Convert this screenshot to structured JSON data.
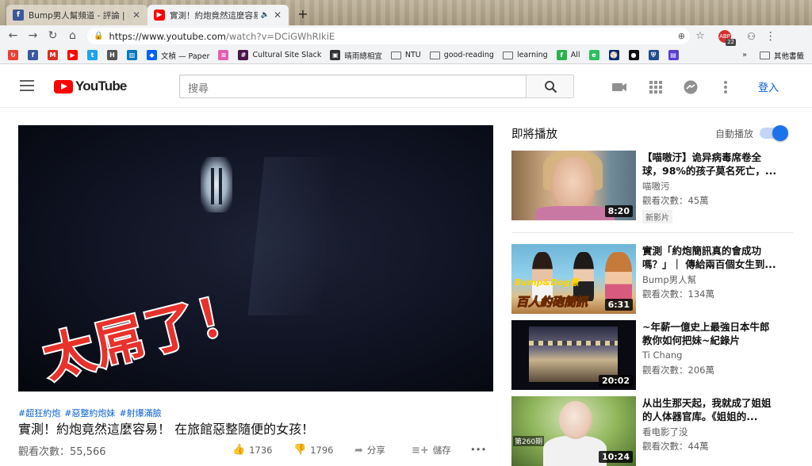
{
  "browser": {
    "tabs": [
      {
        "title": "Bump男人幫頻道 - 評論 | Facebook",
        "favicon": "facebook-icon",
        "active": false
      },
      {
        "title": "實測！約炮竟然這麼容易！在旅館",
        "favicon": "youtube-icon",
        "active": true
      }
    ],
    "url_host": "https://www.youtube.com",
    "url_path": "/watch?v=DCiGWhRIkiE",
    "ext_badge_count": "22",
    "ext_badge_label": "ABP",
    "bookmarks": [
      {
        "label": "",
        "icon": "refresh-red-icon",
        "color": "#e94235"
      },
      {
        "label": "",
        "icon": "facebook-icon",
        "color": "#3b5998"
      },
      {
        "label": "",
        "icon": "gmail-icon",
        "color": "#d93025"
      },
      {
        "label": "",
        "icon": "youtube-icon",
        "color": "#ff0000"
      },
      {
        "label": "",
        "icon": "twitter-icon",
        "color": "#1da1f2"
      },
      {
        "label": "",
        "icon": "hackmd-icon",
        "color": "#555555"
      },
      {
        "label": "",
        "icon": "trello-icon",
        "color": "#0079bf"
      },
      {
        "label": "文楨 — Paper",
        "icon": "dropbox-icon",
        "color": "#0061ff"
      },
      {
        "label": "",
        "icon": "pattern-icon",
        "color": "#e05fae"
      },
      {
        "label": "Cultural Site Slack",
        "icon": "slack-icon",
        "color": "#4a154b"
      },
      {
        "label": "晴雨總相宜",
        "icon": "blog-icon",
        "color": "#333333"
      },
      {
        "label": "NTU",
        "icon": "folder-icon",
        "color": ""
      },
      {
        "label": "good-reading",
        "icon": "folder-icon",
        "color": ""
      },
      {
        "label": "learning",
        "icon": "folder-icon",
        "color": ""
      },
      {
        "label": "All",
        "icon": "feedly-icon",
        "color": "#2bb24c"
      },
      {
        "label": "",
        "icon": "evernote-icon",
        "color": "#2dbe60"
      },
      {
        "label": "",
        "icon": "mlb-icon",
        "color": "#0b2e6b"
      },
      {
        "label": "",
        "icon": "github-icon",
        "color": "#111111"
      },
      {
        "label": "",
        "icon": "shield-icon",
        "color": "#1f4e8c"
      },
      {
        "label": "",
        "icon": "book-icon",
        "color": "#5a3fd1"
      }
    ],
    "bookmarks_more": "»",
    "other_bookmarks": "其他書籤"
  },
  "youtube": {
    "logo_text": "YouTube",
    "search_placeholder": "搜尋",
    "signin": "登入",
    "video": {
      "overlay_text": "太屌了！",
      "hashtags": [
        "#超狂約炮",
        "#惡整約炮妹",
        "#射爆滿臉"
      ],
      "title": "實測！約炮竟然這麼容易！ 在旅館惡整隨便的女孩！",
      "views": "觀看次數：55,566",
      "likes": "1736",
      "dislikes": "1796",
      "share": "分享",
      "save": "儲存",
      "more": "•••"
    },
    "upnext": {
      "heading": "即將播放",
      "autoplay_label": "自動播放",
      "autoplay_on": true,
      "items": [
        {
          "title": "【喵嗷汙】诡异病毒席卷全球，98%的孩子莫名死亡，...",
          "channel": "喵嗷污",
          "views": "觀看次數：45萬",
          "duration": "8:20",
          "badge": "新影片"
        },
        {
          "title": "實測「約炮簡訊真的會成功嗎？」｜ 傳給兩百個女生到...",
          "channel": "Bump男人幫",
          "views": "觀看次數：134萬",
          "duration": "6:31",
          "thumb_text": "Bump&Dog憲",
          "thumb_text2": "百人約砲簡訊"
        },
        {
          "title": "~年薪一億史上最強日本牛郎教你如何把妹~紀錄片",
          "channel": "Ti Chang",
          "views": "觀看次數：206萬",
          "duration": "20:02"
        },
        {
          "title": "从出生那天起，我就成了姐姐的人体器官库。《姐姐的...",
          "channel": "看电影了没",
          "views": "觀看次數：44萬",
          "duration": "10:24",
          "thumb_text": "第260期"
        }
      ]
    }
  }
}
